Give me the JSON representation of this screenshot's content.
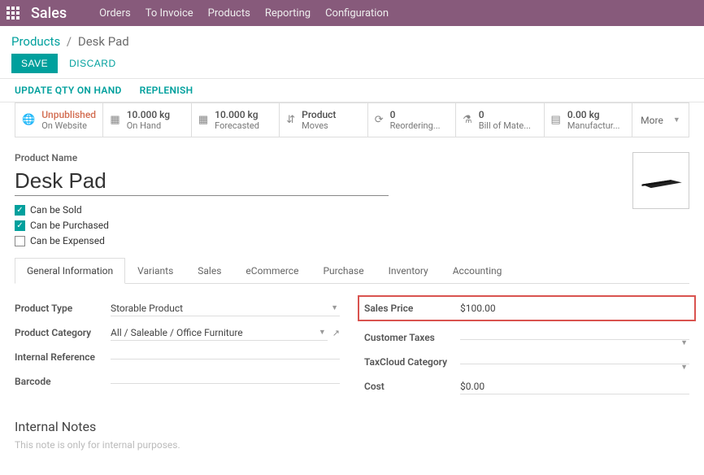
{
  "topbar": {
    "brand": "Sales",
    "nav": [
      "Orders",
      "To Invoice",
      "Products",
      "Reporting",
      "Configuration"
    ]
  },
  "breadcrumbs": {
    "parent": "Products",
    "current": "Desk Pad"
  },
  "actions": {
    "save": "SAVE",
    "discard": "DISCARD"
  },
  "subactions": {
    "update_qty": "UPDATE QTY ON HAND",
    "replenish": "REPLENISH"
  },
  "stats": {
    "unpublished": {
      "value": "Unpublished",
      "label": "On Website"
    },
    "onhand": {
      "value": "10.000 kg",
      "label": "On Hand"
    },
    "forecasted": {
      "value": "10.000 kg",
      "label": "Forecasted"
    },
    "moves": {
      "value": "Product",
      "label": "Moves"
    },
    "reordering": {
      "value": "0",
      "label": "Reordering..."
    },
    "bom": {
      "value": "0",
      "label": "Bill of Mate..."
    },
    "manuf": {
      "value": "0.00 kg",
      "label": "Manufactur..."
    },
    "more": "More"
  },
  "product": {
    "name_label": "Product Name",
    "name": "Desk Pad",
    "can_sold": "Can be Sold",
    "can_purchased": "Can be Purchased",
    "can_expensed": "Can be Expensed"
  },
  "tabs": [
    "General Information",
    "Variants",
    "Sales",
    "eCommerce",
    "Purchase",
    "Inventory",
    "Accounting"
  ],
  "left": {
    "product_type_label": "Product Type",
    "product_type": "Storable Product",
    "category_label": "Product Category",
    "category": "All / Saleable / Office Furniture",
    "internal_ref_label": "Internal Reference",
    "internal_ref": "",
    "barcode_label": "Barcode",
    "barcode": ""
  },
  "right": {
    "sales_price_label": "Sales Price",
    "sales_price": "$100.00",
    "customer_taxes_label": "Customer Taxes",
    "customer_taxes": "",
    "taxcloud_label": "TaxCloud Category",
    "taxcloud": "",
    "cost_label": "Cost",
    "cost": "$0.00"
  },
  "notes": {
    "heading": "Internal Notes",
    "placeholder": "This note is only for internal purposes."
  }
}
